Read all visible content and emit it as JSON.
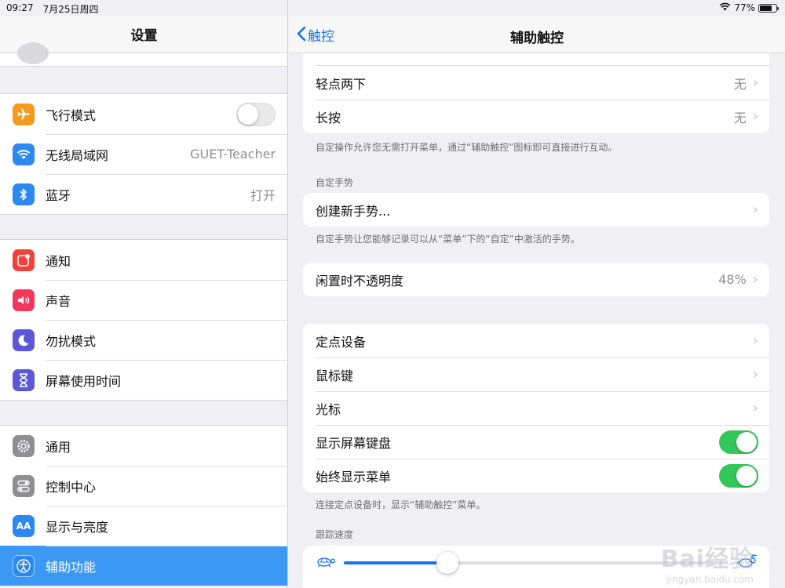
{
  "status_bar": {
    "time": "09:27",
    "date": "7月25日周四",
    "battery": "77%",
    "battery_level": 0.77
  },
  "left": {
    "title": "设置",
    "groups": [
      [
        {
          "label": "飞行模式",
          "icon": "airplane-icon",
          "color": "#f59a1b",
          "toggle": "off"
        },
        {
          "label": "无线局域网",
          "icon": "wifi-icon",
          "color": "#2d88f0",
          "value": "GUET-Teacher"
        },
        {
          "label": "蓝牙",
          "icon": "bluetooth-icon",
          "color": "#2d88f0",
          "value": "打开"
        }
      ],
      [
        {
          "label": "通知",
          "icon": "notification-icon",
          "color": "#f2423b"
        },
        {
          "label": "声音",
          "icon": "speaker-icon",
          "color": "#f2385a"
        },
        {
          "label": "勿扰模式",
          "icon": "moon-icon",
          "color": "#5b57d6"
        },
        {
          "label": "屏幕使用时间",
          "icon": "hourglass-icon",
          "color": "#5b57d6"
        }
      ],
      [
        {
          "label": "通用",
          "icon": "gear-icon",
          "color": "#8e8e93"
        },
        {
          "label": "控制中心",
          "icon": "switches-icon",
          "color": "#8e8e93"
        },
        {
          "label": "显示与亮度",
          "icon": "text-size-icon",
          "color": "#2d88f0",
          "glyph": "AA"
        },
        {
          "label": "辅助功能",
          "icon": "accessibility-icon",
          "color": "#2d88f0",
          "selected": true
        }
      ]
    ]
  },
  "right": {
    "back_label": "触控",
    "title": "辅助触控",
    "actions": [
      {
        "label": "轻点两下",
        "value": "无"
      },
      {
        "label": "长按",
        "value": "无"
      }
    ],
    "actions_note": "自定操作允许您无需打开菜单，通过“辅助触控”图标即可直接进行互动。",
    "gestures_header": "自定手势",
    "create_gesture": "创建新手势...",
    "gestures_note": "自定手势让您能够记录可以从“菜单”下的“自定”中激活的手势。",
    "idle_opacity": {
      "label": "闲置时不透明度",
      "value": "48%"
    },
    "pointer": [
      {
        "label": "定点设备",
        "type": "chevron"
      },
      {
        "label": "鼠标键",
        "type": "chevron"
      },
      {
        "label": "光标",
        "type": "chevron"
      },
      {
        "label": "显示屏幕键盘",
        "type": "toggle",
        "state": "on"
      },
      {
        "label": "始终显示菜单",
        "type": "toggle",
        "state": "on"
      }
    ],
    "pointer_note": "连接定点设备时，显示“辅助触控”菜单。",
    "tracking_header": "跟踪速度",
    "tracking_speed": 0.27
  },
  "watermark": {
    "text": "Bai经验",
    "sub": "jingyan.baidu.com"
  },
  "colors": {
    "accent": "#1a73e8",
    "toggle_on": "#33c659",
    "selected_row": "#3c99f3"
  }
}
